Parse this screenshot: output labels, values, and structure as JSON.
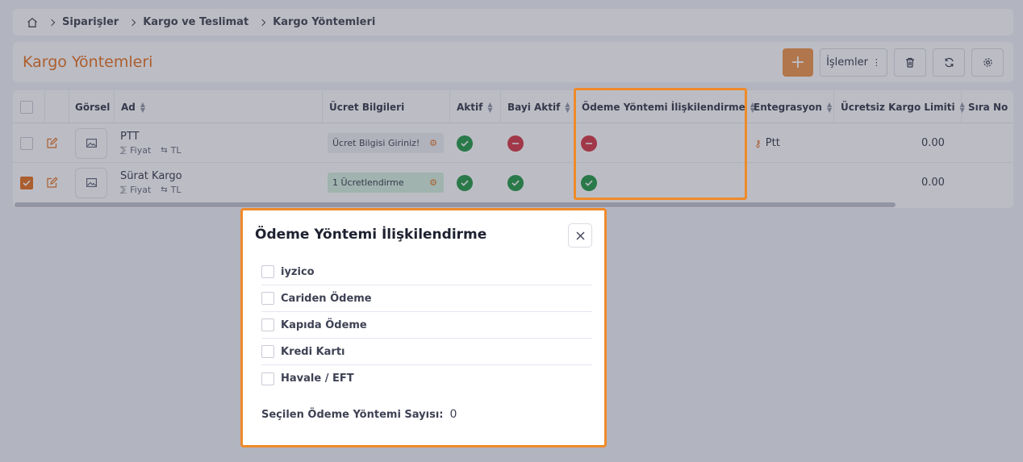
{
  "breadcrumb": [
    "Siparişler",
    "Kargo ve Teslimat",
    "Kargo Yöntemleri"
  ],
  "page": {
    "title": "Kargo Yöntemleri",
    "actions_label": "İşlemler"
  },
  "table": {
    "columns": [
      "Görsel",
      "Ad",
      "Ücret Bilgileri",
      "Aktif",
      "Bayi Aktif",
      "Ödeme Yöntemi İlişkilendirme",
      "Entegrasyon",
      "Ücretsiz Kargo Limiti",
      "Sıra No"
    ],
    "rows": [
      {
        "name": "PTT",
        "price_label": "Fiyat",
        "currency": "TL",
        "fee_info": "Ücret Bilgisi Giriniz!",
        "fee_state": "empty",
        "active": true,
        "dealer_active": false,
        "payment_linked": false,
        "integration": "Ptt",
        "free_limit": "0.00",
        "selected": false
      },
      {
        "name": "Sürat Kargo",
        "price_label": "Fiyat",
        "currency": "TL",
        "fee_info": "1 Ücretlendirme",
        "fee_state": "set",
        "active": true,
        "dealer_active": true,
        "payment_linked": true,
        "integration": "",
        "free_limit": "0.00",
        "selected": true
      }
    ]
  },
  "modal": {
    "title": "Ödeme Yöntemi İlişkilendirme",
    "options": [
      "iyzico",
      "Cariden Ödeme",
      "Kapıda Ödeme",
      "Kredi Kartı",
      "Havale / EFT"
    ],
    "selected_count_label": "Seçilen Ödeme Yöntemi Sayısı:",
    "selected_count": "0"
  },
  "colors": {
    "accent": "#e8782a",
    "highlight_border": "#ef8a2a",
    "success": "#2e9e50",
    "danger": "#d9414f"
  }
}
